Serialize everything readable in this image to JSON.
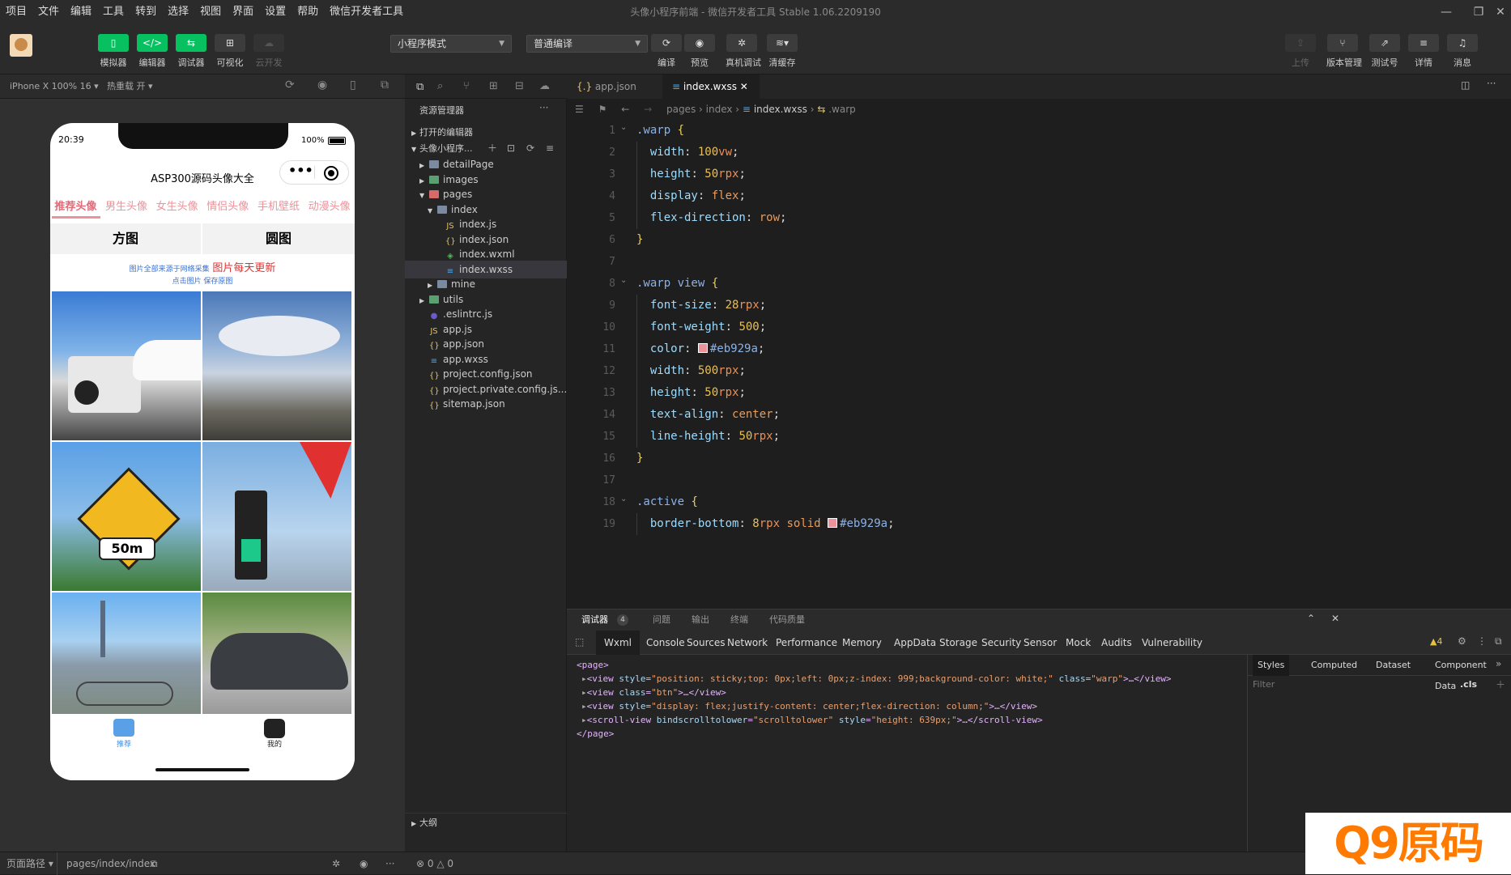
{
  "menu": [
    "项目",
    "文件",
    "编辑",
    "工具",
    "转到",
    "选择",
    "视图",
    "界面",
    "设置",
    "帮助",
    "微信开发者工具"
  ],
  "window_title": "头像小程序前端 - 微信开发者工具 Stable 1.06.2209190",
  "toolbar": {
    "simulator": "模拟器",
    "editor": "编辑器",
    "debugger": "调试器",
    "visual": "可视化",
    "cloud": "云开发",
    "mode_select": "小程序模式",
    "compile_select": "普通编译",
    "compile": "编译",
    "preview": "预览",
    "real_debug": "真机调试",
    "clear_cache": "清缓存",
    "upload": "上传",
    "version": "版本管理",
    "test": "测试号",
    "detail": "详情",
    "message": "消息"
  },
  "sim_bar": {
    "device": "iPhone X 100% 16",
    "hot_reload": "热重载 开"
  },
  "phone": {
    "time": "20:39",
    "battery": "100%",
    "nav_title": "ASP300源码头像大全",
    "categories": [
      "推荐头像",
      "男生头像",
      "女生头像",
      "情侣头像",
      "手机壁纸",
      "动漫头像"
    ],
    "btn_square": "方图",
    "btn_round": "圆图",
    "notice_small": "图片全部来源于网络采集",
    "notice_red": "图片每天更新",
    "notice_tip": "点击图片 保存原图",
    "tab_recommend": "推荐",
    "tab_mine": "我的"
  },
  "explorer": {
    "title": "资源管理器",
    "open_editors": "打开的编辑器",
    "project": "头像小程序...",
    "items": [
      {
        "name": "detailPage",
        "type": "folder",
        "depth": 1
      },
      {
        "name": "images",
        "type": "folder",
        "depth": 1
      },
      {
        "name": "pages",
        "type": "folder",
        "depth": 1
      },
      {
        "name": "index",
        "type": "folder",
        "depth": 2
      },
      {
        "name": "index.js",
        "type": "js",
        "depth": 3
      },
      {
        "name": "index.json",
        "type": "json",
        "depth": 3
      },
      {
        "name": "index.wxml",
        "type": "wxml",
        "depth": 3
      },
      {
        "name": "index.wxss",
        "type": "wxss",
        "depth": 3
      },
      {
        "name": "mine",
        "type": "folder",
        "depth": 2
      },
      {
        "name": "utils",
        "type": "folder",
        "depth": 1
      },
      {
        "name": ".eslintrc.js",
        "type": "eslint",
        "depth": 1
      },
      {
        "name": "app.js",
        "type": "js",
        "depth": 1
      },
      {
        "name": "app.json",
        "type": "json",
        "depth": 1
      },
      {
        "name": "app.wxss",
        "type": "wxss",
        "depth": 1
      },
      {
        "name": "project.config.json",
        "type": "json",
        "depth": 1
      },
      {
        "name": "project.private.config.js...",
        "type": "json",
        "depth": 1
      },
      {
        "name": "sitemap.json",
        "type": "json",
        "depth": 1
      }
    ],
    "outline": "大纲"
  },
  "editor": {
    "tab1": "app.json",
    "tab2": "index.wxss",
    "crumb_pages": "pages",
    "crumb_index": "index",
    "crumb_file": "index.wxss",
    "crumb_sel": ".warp",
    "lines": [
      {
        "n": "1",
        "t": ".warp {"
      },
      {
        "n": "2",
        "t": "  width: 100vw;"
      },
      {
        "n": "3",
        "t": "  height: 50rpx;"
      },
      {
        "n": "4",
        "t": "  display: flex;"
      },
      {
        "n": "5",
        "t": "  flex-direction: row;"
      },
      {
        "n": "6",
        "t": "}"
      },
      {
        "n": "7",
        "t": ""
      },
      {
        "n": "8",
        "t": ".warp view {"
      },
      {
        "n": "9",
        "t": "  font-size: 28rpx;"
      },
      {
        "n": "10",
        "t": "  font-weight: 500;"
      },
      {
        "n": "11",
        "t": "  color: #eb929a;"
      },
      {
        "n": "12",
        "t": "  width: 500rpx;"
      },
      {
        "n": "13",
        "t": "  height: 50rpx;"
      },
      {
        "n": "14",
        "t": "  text-align: center;"
      },
      {
        "n": "15",
        "t": "  line-height: 50rpx;"
      },
      {
        "n": "16",
        "t": "}"
      },
      {
        "n": "17",
        "t": ""
      },
      {
        "n": "18",
        "t": ".active {"
      },
      {
        "n": "19",
        "t": "  border-bottom: 8rpx solid #eb929a;"
      }
    ]
  },
  "devtools": {
    "top_tabs": [
      "调试器",
      "问题",
      "输出",
      "终端",
      "代码质量"
    ],
    "badge": "4",
    "tabs": [
      "Wxml",
      "Console",
      "Sources",
      "Network",
      "Performance",
      "Memory",
      "AppData",
      "Storage",
      "Security",
      "Sensor",
      "Mock",
      "Audits",
      "Vulnerability"
    ],
    "warn": "4",
    "xml": [
      "<page>",
      "<view style=\"position: sticky;top: 0px;left: 0px;z-index: 999;background-color: white;\" class=\"warp\">…</view>",
      "<view class=\"btn\">…</view>",
      "<view style=\"display: flex;justify-content: center;flex-direction: column;\">…</view>",
      "<scroll-view bindscrolltolower=\"scrolltolower\" style=\"height: 639px;\">…</scroll-view>",
      "</page>"
    ],
    "style_tabs": [
      "Styles",
      "Computed",
      "Dataset",
      "Component Data"
    ],
    "filter": "Filter",
    "cls": ".cls"
  },
  "status": {
    "path_label": "页面路径",
    "path": "pages/index/index",
    "errors": "0",
    "warnings": "0"
  },
  "watermark": "Q9原码",
  "colors": {
    "accent": "#07c160",
    "pink": "#eb929a"
  }
}
